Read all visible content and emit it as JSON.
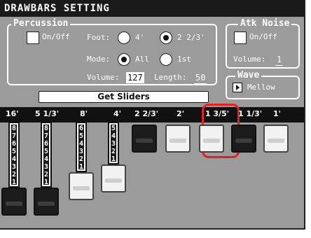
{
  "title": "DRAWBARS SETTING",
  "percussion": {
    "legend": "Percussion",
    "onoff_label": "On/Off",
    "foot_label": "Foot:",
    "foot_opt1": "4'",
    "foot_opt2": "2 2/3'",
    "foot_selected": "2 2/3'",
    "mode_label": "Mode:",
    "mode_opt1": "All",
    "mode_opt2": "1st",
    "mode_selected": "All",
    "volume_label": "Volume:",
    "volume_value": "127",
    "length_label": "Length:",
    "length_value": "50"
  },
  "atk_noise": {
    "legend": "Atk Noise",
    "onoff_label": "On/Off",
    "volume_label": "Volume:",
    "volume_value": "1"
  },
  "wave": {
    "legend": "Wave",
    "value": "Mellow"
  },
  "get_sliders_label": "Get Sliders",
  "drawbars": [
    {
      "label": "16'",
      "level": 8,
      "color": "black"
    },
    {
      "label": "5 1/3'",
      "level": 8,
      "color": "black"
    },
    {
      "label": "8'",
      "level": 6,
      "color": "white"
    },
    {
      "label": "4'",
      "level": 5,
      "color": "white"
    },
    {
      "label": "2 2/3'",
      "level": 0,
      "color": "black"
    },
    {
      "label": "2'",
      "level": 0,
      "color": "white"
    },
    {
      "label": "1 3/5'",
      "level": 0,
      "color": "white",
      "selected": true
    },
    {
      "label": "1 1/3'",
      "level": 0,
      "color": "black"
    },
    {
      "label": "1'",
      "level": 0,
      "color": "white"
    }
  ],
  "colors": {
    "panel_bg": "#9b9b9b",
    "titlebar_bg": "#1a1a1a",
    "highlight": "#e42020"
  }
}
